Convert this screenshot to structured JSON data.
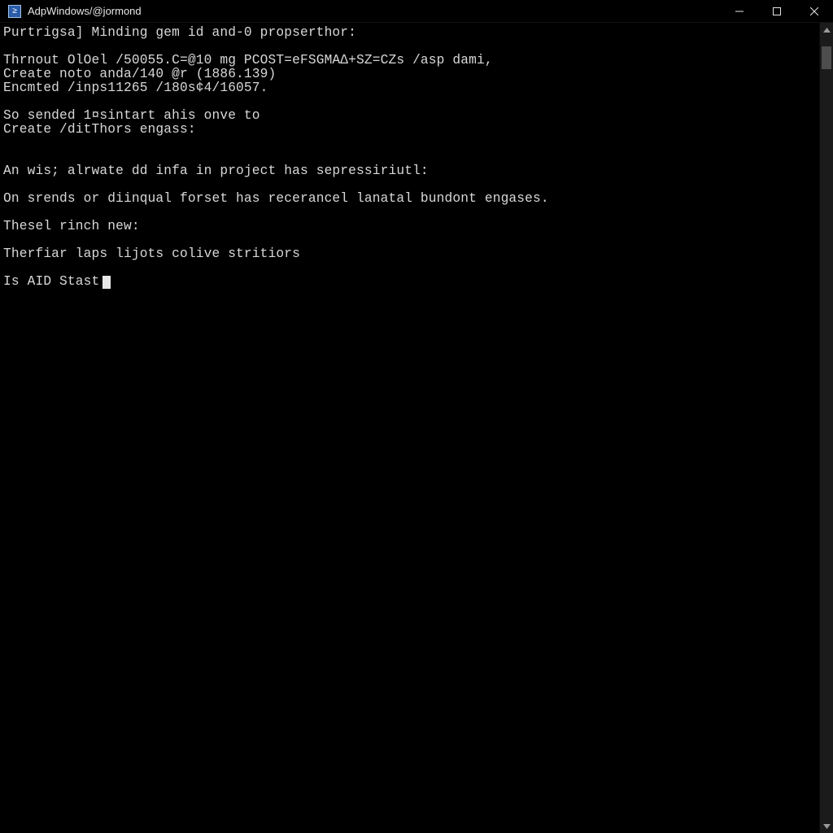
{
  "titlebar": {
    "title": "AdpWindows/@jormond"
  },
  "terminal": {
    "lines": [
      "Purtrigsa] Minding gem id and-0 propserthor:",
      "",
      "Thrnout OlOel /50055.C=@10 mg PCOST=eFSGMA∆+SZ=CZs /asp dami,",
      "Create noto anda/140 @r (1886.139)",
      "Encmted /inps11265 /180s¢4/16057.",
      "",
      "So sended 1¤sintart ahis onve to",
      "Create /ditThors engass:",
      "",
      "",
      "An wis; alrwate dd infa in project has sepressiriutl:",
      "",
      "On srends or diinqual forset has recerancel lanatal bundont engases.",
      "",
      "Thesel rinch new:",
      "",
      "Therfiar laps lijots colive stritiors"
    ],
    "prompt": "Is AID Stast"
  }
}
